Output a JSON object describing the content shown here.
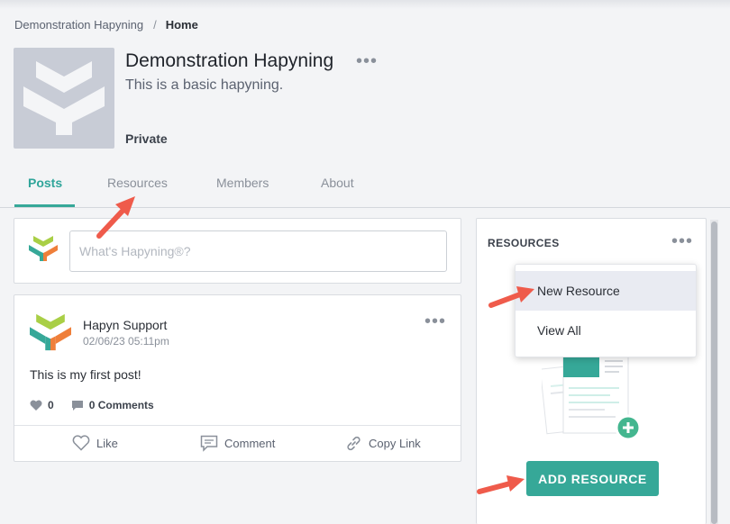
{
  "breadcrumb": {
    "parent": "Demonstration Hapyning",
    "separator": "/",
    "current": "Home"
  },
  "group": {
    "title": "Demonstration Hapyning",
    "description": "This is a basic hapyning.",
    "privacy": "Private",
    "more_icon": "ellipsis-icon"
  },
  "tabs": [
    {
      "label": "Posts",
      "active": true
    },
    {
      "label": "Resources",
      "active": false
    },
    {
      "label": "Members",
      "active": false
    },
    {
      "label": "About",
      "active": false
    }
  ],
  "composer": {
    "placeholder": "What's Hapyning®?"
  },
  "post": {
    "author": "Hapyn Support",
    "timestamp": "02/06/23 05:11pm",
    "body": "This is my first post!",
    "likes": "0",
    "comments": "0 Comments",
    "actions": {
      "like": "Like",
      "comment": "Comment",
      "copy_link": "Copy Link"
    }
  },
  "resources_panel": {
    "heading": "RESOURCES",
    "menu": [
      "New Resource",
      "View All"
    ],
    "add_button": "ADD RESOURCE"
  },
  "colors": {
    "accent": "#36a898",
    "annotation_arrow": "#ef5b4b",
    "logo_green": "#a9cf46",
    "logo_teal": "#36a898",
    "logo_orange": "#ef7f3a"
  }
}
